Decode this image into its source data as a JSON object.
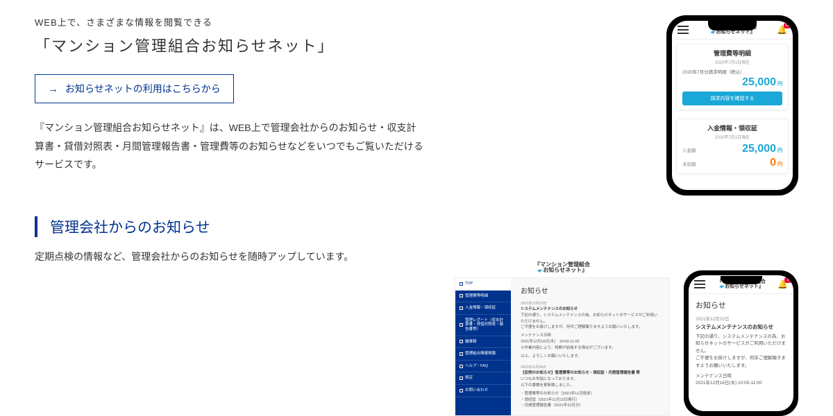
{
  "intro": {
    "small": "WEB上で、さまざまな情報を閲覧できる",
    "title": "「マンション管理組合お知らせネット」",
    "cta": "お知らせネットの利用はこちらから",
    "desc": "『マンション管理組合お知らせネット』は、WEB上で管理会社からのお知らせ・収支計算書・貸借対照表・月間管理報告書・管理費等のお知らせなどをいつでもご覧いただけるサービスです。"
  },
  "phone1": {
    "logo1": "『マンション管理組合",
    "logo2": "お知らせネット』",
    "badge": "12",
    "card1": {
      "title": "管理費等明細",
      "sub": "2020年7月1日現在",
      "label": "2020年7月分請求明細（税込）",
      "amount": "25,000",
      "yen": "円",
      "btn": "請求内容を確認する"
    },
    "card2": {
      "title": "入金情報・領収証",
      "sub": "2020年7月1日現在",
      "r1_label": "入金額",
      "r1_amount": "25,000",
      "r2_label": "未収額",
      "r2_amount": "0",
      "yen": "円"
    }
  },
  "section2": {
    "heading": "管理会社からのお知らせ",
    "desc": "定期点検の情報など、管理会社からのお知らせを随時アップしています。"
  },
  "desktop": {
    "logo1": "『マンション管理組合",
    "logo2": "お知らせネット』",
    "menu": [
      "TOP",
      "管理費等明細",
      "入金情報・領収証",
      "管理レポート（収支計算書・貸借対照表・報告書等）",
      "議事録",
      "管理組合関連情報",
      "ヘルプ・FAQ",
      "設定",
      "お問い合わせ"
    ],
    "heading": "お知らせ",
    "post1": {
      "date": "2021年12月15日",
      "title": "システムメンテナンスのお知らせ",
      "body1": "下記の通り、システムメンテナンスの為、お知らせネットのサービスがご利用いただけません。",
      "body2": "ご不便をお掛けしますが、何卒ご理解賜りますようお願いいたします。",
      "body3": "メンテナンス日時",
      "body4": "2021年12月16日(木)　10:00-11:00",
      "body5": "※作業内容により、時間が前後する場合がございます。",
      "body6": "以上、よろしくお願いいたします。"
    },
    "post2": {
      "date": "2021年11月26日",
      "title": "【定例のお知らせ】管理費等のお知らせ・領収証・月間管理報告書 等",
      "body1": "いつもお世話になっております。",
      "body2": "以下の書類を更新致しました。",
      "body3": "・管理費等のお知らせ（2021年11月請求）",
      "body4": "・領収証（2021年11月12日発行）",
      "body5": "・月間管理報告書（2021年10月分）"
    }
  },
  "phone2": {
    "logo1": "『マンション管理組合",
    "logo2": "お知らせネット』",
    "badge": "3",
    "heading": "お知らせ",
    "date": "2021年12月15日",
    "title": "システムメンテナンスのお知らせ",
    "body1": "下記の通り、システムメンテナンスの為、お知らせネットのサービスがご利用いただけません。",
    "body2": "ご不便をお掛けしますが、何卒ご理解賜きますようお願いいたします。",
    "body3": "メンテナンス日時",
    "body4": "2021年12月16日(木)  10:00-11:00"
  }
}
